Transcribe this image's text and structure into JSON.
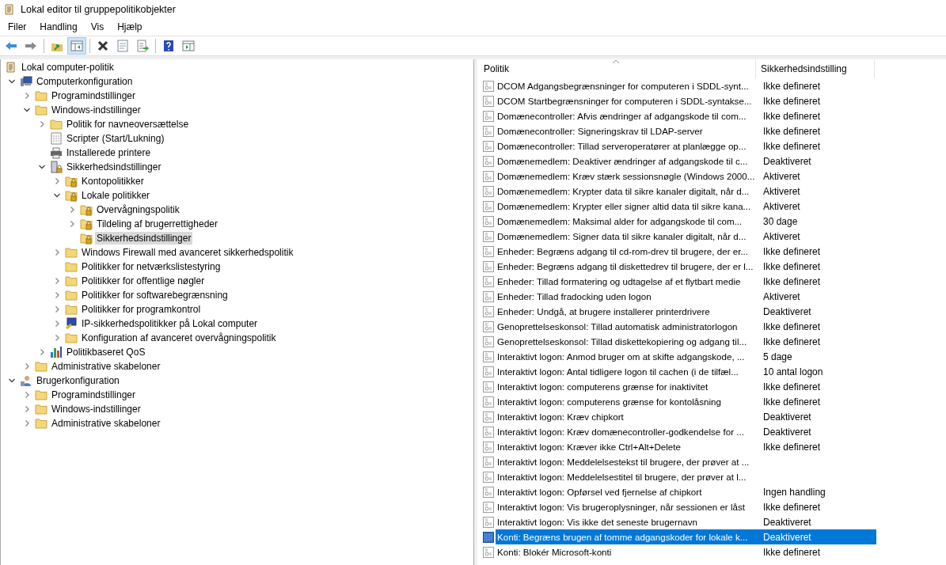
{
  "window": {
    "title": "Lokal editor til gruppepolitikobjekter"
  },
  "menu": [
    "Filer",
    "Handling",
    "Vis",
    "Hjælp"
  ],
  "toolbar": [
    {
      "kind": "back",
      "pressed": false
    },
    {
      "kind": "forward",
      "pressed": false
    },
    {
      "kind": "sep"
    },
    {
      "kind": "up",
      "pressed": false
    },
    {
      "kind": "tree",
      "pressed": true
    },
    {
      "kind": "sep"
    },
    {
      "kind": "delete",
      "pressed": false
    },
    {
      "kind": "properties",
      "pressed": false
    },
    {
      "kind": "export",
      "pressed": false
    },
    {
      "kind": "sep"
    },
    {
      "kind": "help",
      "pressed": false
    },
    {
      "kind": "pane",
      "pressed": false
    }
  ],
  "tree": [
    {
      "label": "Lokal computer-politik",
      "kind": "doc",
      "selected": false,
      "children": [
        {
          "label": "Computerkonfiguration",
          "kind": "computer",
          "expanded": true,
          "selected": false,
          "children": [
            {
              "label": "Programindstillinger",
              "kind": "folder",
              "expanded": false,
              "selected": false
            },
            {
              "label": "Windows-indstillinger",
              "kind": "folder",
              "expanded": true,
              "selected": false,
              "children": [
                {
                  "label": "Politik for navneoversættelse",
                  "kind": "folder",
                  "expanded": false,
                  "selected": false
                },
                {
                  "label": "Scripter (Start/Lukning)",
                  "kind": "script",
                  "selected": false
                },
                {
                  "label": "Installerede printere",
                  "kind": "printer",
                  "selected": false
                },
                {
                  "label": "Sikkerhedsindstillinger",
                  "kind": "security",
                  "expanded": true,
                  "selected": false,
                  "children": [
                    {
                      "label": "Kontopolitikker",
                      "kind": "lockfolder",
                      "expanded": false,
                      "selected": false
                    },
                    {
                      "label": "Lokale politikker",
                      "kind": "lockfolder",
                      "expanded": true,
                      "selected": false,
                      "children": [
                        {
                          "label": "Overvågningspolitik",
                          "kind": "lockfolder",
                          "expanded": false,
                          "selected": false
                        },
                        {
                          "label": "Tildeling af brugerrettigheder",
                          "kind": "lockfolder",
                          "expanded": false,
                          "selected": false
                        },
                        {
                          "label": "Sikkerhedsindstillinger",
                          "kind": "lockfolder",
                          "selected": true
                        }
                      ]
                    },
                    {
                      "label": "Windows Firewall med avanceret sikkerhedspolitik",
                      "kind": "folder",
                      "expanded": false,
                      "selected": false
                    },
                    {
                      "label": "Politikker for netværkslistestyring",
                      "kind": "folder",
                      "selected": false
                    },
                    {
                      "label": "Politikker for offentlige nøgler",
                      "kind": "folder",
                      "expanded": false,
                      "selected": false
                    },
                    {
                      "label": "Politikker for softwarebegrænsning",
                      "kind": "folder",
                      "expanded": false,
                      "selected": false
                    },
                    {
                      "label": "Politikker for programkontrol",
                      "kind": "folder",
                      "expanded": false,
                      "selected": false
                    },
                    {
                      "label": "IP-sikkerhedspolitikker på Lokal computer",
                      "kind": "ipsec",
                      "expanded": false,
                      "selected": false
                    },
                    {
                      "label": "Konfiguration af avanceret overvågningspolitik",
                      "kind": "folder",
                      "expanded": false,
                      "selected": false
                    }
                  ]
                },
                {
                  "label": "Politikbaseret QoS",
                  "kind": "chart",
                  "expanded": false,
                  "selected": false
                }
              ]
            },
            {
              "label": "Administrative skabeloner",
              "kind": "folder",
              "expanded": false,
              "selected": false
            }
          ]
        },
        {
          "label": "Brugerkonfiguration",
          "kind": "user",
          "expanded": true,
          "selected": false,
          "children": [
            {
              "label": "Programindstillinger",
              "kind": "folder",
              "expanded": false,
              "selected": false
            },
            {
              "label": "Windows-indstillinger",
              "kind": "folder",
              "expanded": false,
              "selected": false
            },
            {
              "label": "Administrative skabeloner",
              "kind": "folder",
              "expanded": false,
              "selected": false
            }
          ]
        }
      ]
    }
  ],
  "table": {
    "columns": [
      "Politik",
      "Sikkerhedsindstilling"
    ],
    "rows": [
      {
        "policy": "DCOM Adgangsbegrænsninger for computeren i SDDL-synt...",
        "setting": "Ikke defineret",
        "selected": false
      },
      {
        "policy": "DCOM Startbegrænsninger for computeren i SDDL-syntakse...",
        "setting": "Ikke defineret",
        "selected": false
      },
      {
        "policy": "Domænecontroller: Afvis ændringer af adgangskode til com...",
        "setting": "Ikke defineret",
        "selected": false
      },
      {
        "policy": "Domænecontroller: Signeringskrav til LDAP-server",
        "setting": "Ikke defineret",
        "selected": false
      },
      {
        "policy": "Domænecontroller: Tillad serveroperatører at planlægge op...",
        "setting": "Ikke defineret",
        "selected": false
      },
      {
        "policy": "Domænemedlem: Deaktiver ændringer af adgangskode til c...",
        "setting": "Deaktiveret",
        "selected": false
      },
      {
        "policy": "Domænemedlem: Kræv stærk sessionsnøgle (Windows 2000...",
        "setting": "Aktiveret",
        "selected": false
      },
      {
        "policy": "Domænemedlem: Krypter data til sikre kanaler digitalt, når d...",
        "setting": "Aktiveret",
        "selected": false
      },
      {
        "policy": "Domænemedlem: Krypter eller signer altid data til sikre kana...",
        "setting": "Aktiveret",
        "selected": false
      },
      {
        "policy": "Domænemedlem: Maksimal alder for adgangskode til com...",
        "setting": "30 dage",
        "selected": false
      },
      {
        "policy": "Domænemedlem: Signer data til sikre kanaler digitalt, når d...",
        "setting": "Aktiveret",
        "selected": false
      },
      {
        "policy": "Enheder: Begræns adgang til cd-rom-drev til brugere, der er...",
        "setting": "Ikke defineret",
        "selected": false
      },
      {
        "policy": "Enheder: Begræns adgang til diskettedrev til brugere, der er l...",
        "setting": "Ikke defineret",
        "selected": false
      },
      {
        "policy": "Enheder: Tillad formatering og udtagelse af et flytbart medie",
        "setting": "Ikke defineret",
        "selected": false
      },
      {
        "policy": "Enheder: Tillad fradocking uden logon",
        "setting": "Aktiveret",
        "selected": false
      },
      {
        "policy": "Enheder: Undgå, at brugere installerer printerdrivere",
        "setting": "Deaktiveret",
        "selected": false
      },
      {
        "policy": "Genoprettelseskonsol: Tillad automatisk administratorlogon",
        "setting": "Ikke defineret",
        "selected": false
      },
      {
        "policy": "Genoprettelseskonsol: Tillad diskettekopiering og adgang til...",
        "setting": "Ikke defineret",
        "selected": false
      },
      {
        "policy": "Interaktivt logon: Anmod bruger om at skifte adgangskode, ...",
        "setting": "5 dage",
        "selected": false
      },
      {
        "policy": "Interaktivt logon: Antal tidligere logon til cachen (i de tilfæl...",
        "setting": "10 antal logon",
        "selected": false
      },
      {
        "policy": "Interaktivt logon: computerens grænse for inaktivitet",
        "setting": "Ikke defineret",
        "selected": false
      },
      {
        "policy": "Interaktivt logon: computerens grænse for kontolåsning",
        "setting": "Ikke defineret",
        "selected": false
      },
      {
        "policy": "Interaktivt logon: Kræv chipkort",
        "setting": "Deaktiveret",
        "selected": false
      },
      {
        "policy": "Interaktivt logon: Kræv domænecontroller-godkendelse for ...",
        "setting": "Deaktiveret",
        "selected": false
      },
      {
        "policy": "Interaktivt logon: Kræver ikke Ctrl+Alt+Delete",
        "setting": "Ikke defineret",
        "selected": false
      },
      {
        "policy": "Interaktivt logon: Meddelelsestekst til brugere, der prøver at ...",
        "selected": false
      },
      {
        "policy": "Interaktivt logon: Meddelelsestitel til brugere, der prøver at l...",
        "selected": false
      },
      {
        "policy": "Interaktivt logon: Opførsel ved fjernelse af chipkort",
        "setting": "Ingen handling",
        "selected": false
      },
      {
        "policy": "Interaktivt logon: Vis brugeroplysninger, når sessionen er låst",
        "setting": "Ikke defineret",
        "selected": false
      },
      {
        "policy": "Interaktivt logon: Vis ikke det seneste brugernavn",
        "setting": "Deaktiveret",
        "selected": false
      },
      {
        "policy": "Konti: Begræns brugen af tomme adgangskoder for lokale k...",
        "setting": "Deaktiveret",
        "selected": true
      },
      {
        "policy": "Konti: Blokér Microsoft-konti",
        "setting": "Ikke defineret",
        "selected": false
      }
    ]
  }
}
